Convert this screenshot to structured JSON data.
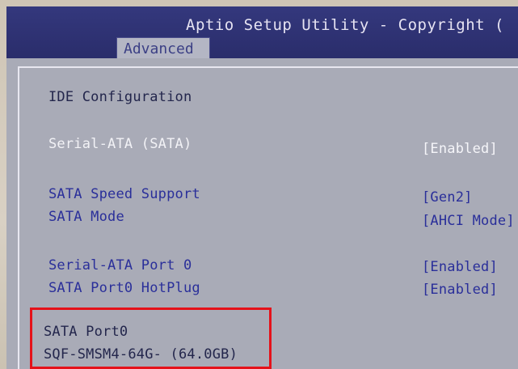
{
  "header": {
    "title": "Aptio Setup Utility - Copyright (",
    "active_tab": "Advanced"
  },
  "page": {
    "section_title": "IDE Configuration"
  },
  "settings": [
    {
      "label": "Serial-ATA (SATA)",
      "value": "[Enabled]"
    },
    {
      "label": "SATA Speed Support",
      "value": "[Gen2]"
    },
    {
      "label": "SATA Mode",
      "value": "[AHCI Mode]"
    },
    {
      "label": "Serial-ATA Port 0",
      "value": "[Enabled]"
    },
    {
      "label": "SATA Port0 HotPlug",
      "value": "[Enabled]"
    }
  ],
  "device": {
    "port_label": "SATA Port0",
    "device_name": "SQF-SMSM4-64G- (64.0GB)"
  },
  "colors": {
    "title_bar": "#2a2d6b",
    "panel_bg": "#a9abb7",
    "selected_text": "#f2f2f6",
    "option_text": "#2a2f9a",
    "annotation_border": "#e5121a"
  }
}
